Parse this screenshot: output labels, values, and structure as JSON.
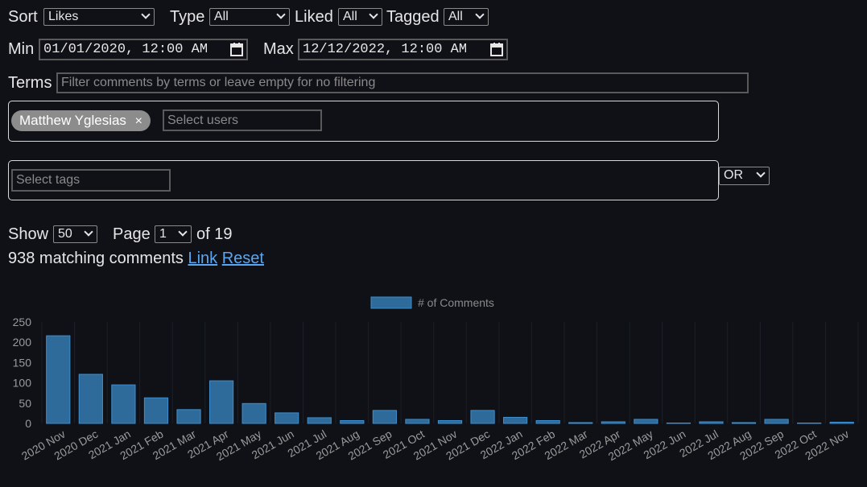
{
  "filters": {
    "sort_label": "Sort",
    "sort_value": "Likes",
    "type_label": "Type",
    "type_value": "All",
    "liked_label": "Liked",
    "liked_value": "All",
    "tagged_label": "Tagged",
    "tagged_value": "All",
    "min_label": "Min",
    "min_value": "01/01/2020, 12:00 AM",
    "max_label": "Max",
    "max_value": "12/12/2022, 12:00 AM",
    "terms_label": "Terms",
    "terms_placeholder": "Filter comments by terms or leave empty for no filtering",
    "users_chip": "Matthew Yglesias",
    "users_chip_remove": "×",
    "users_placeholder": "Select users",
    "tags_placeholder": "Select tags",
    "tags_mode": "OR"
  },
  "paging": {
    "show_label": "Show",
    "show_value": "50",
    "page_label": "Page",
    "page_value": "1",
    "of_text": "of 19",
    "matching_text": "938 matching comments",
    "link_label": "Link",
    "reset_label": "Reset"
  },
  "colors": {
    "bar_fill": "#2e6a9a",
    "bar_stroke": "#3d8fcf",
    "link": "#5aa6f0"
  },
  "chart_data": {
    "type": "bar",
    "legend": "# of Comments",
    "legend_position": "top-center",
    "grid": true,
    "ylim": [
      0,
      250
    ],
    "yticks": [
      0,
      50,
      100,
      150,
      200,
      250
    ],
    "categories": [
      "2020 Nov",
      "2020 Dec",
      "2021 Jan",
      "2021 Feb",
      "2021 Mar",
      "2021 Apr",
      "2021 May",
      "2021 Jun",
      "2021 Jul",
      "2021 Aug",
      "2021 Sep",
      "2021 Oct",
      "2021 Nov",
      "2021 Dec",
      "2022 Jan",
      "2022 Feb",
      "2022 Mar",
      "2022 Apr",
      "2022 May",
      "2022 Jun",
      "2022 Jul",
      "2022 Aug",
      "2022 Sep",
      "2022 Oct",
      "2022 Nov"
    ],
    "series": [
      {
        "name": "# of Comments",
        "values": [
          216,
          121,
          95,
          63,
          34,
          105,
          49,
          26,
          14,
          7,
          32,
          10,
          7,
          32,
          15,
          7,
          1,
          4,
          10,
          0,
          4,
          1,
          10,
          0,
          3
        ]
      }
    ]
  }
}
